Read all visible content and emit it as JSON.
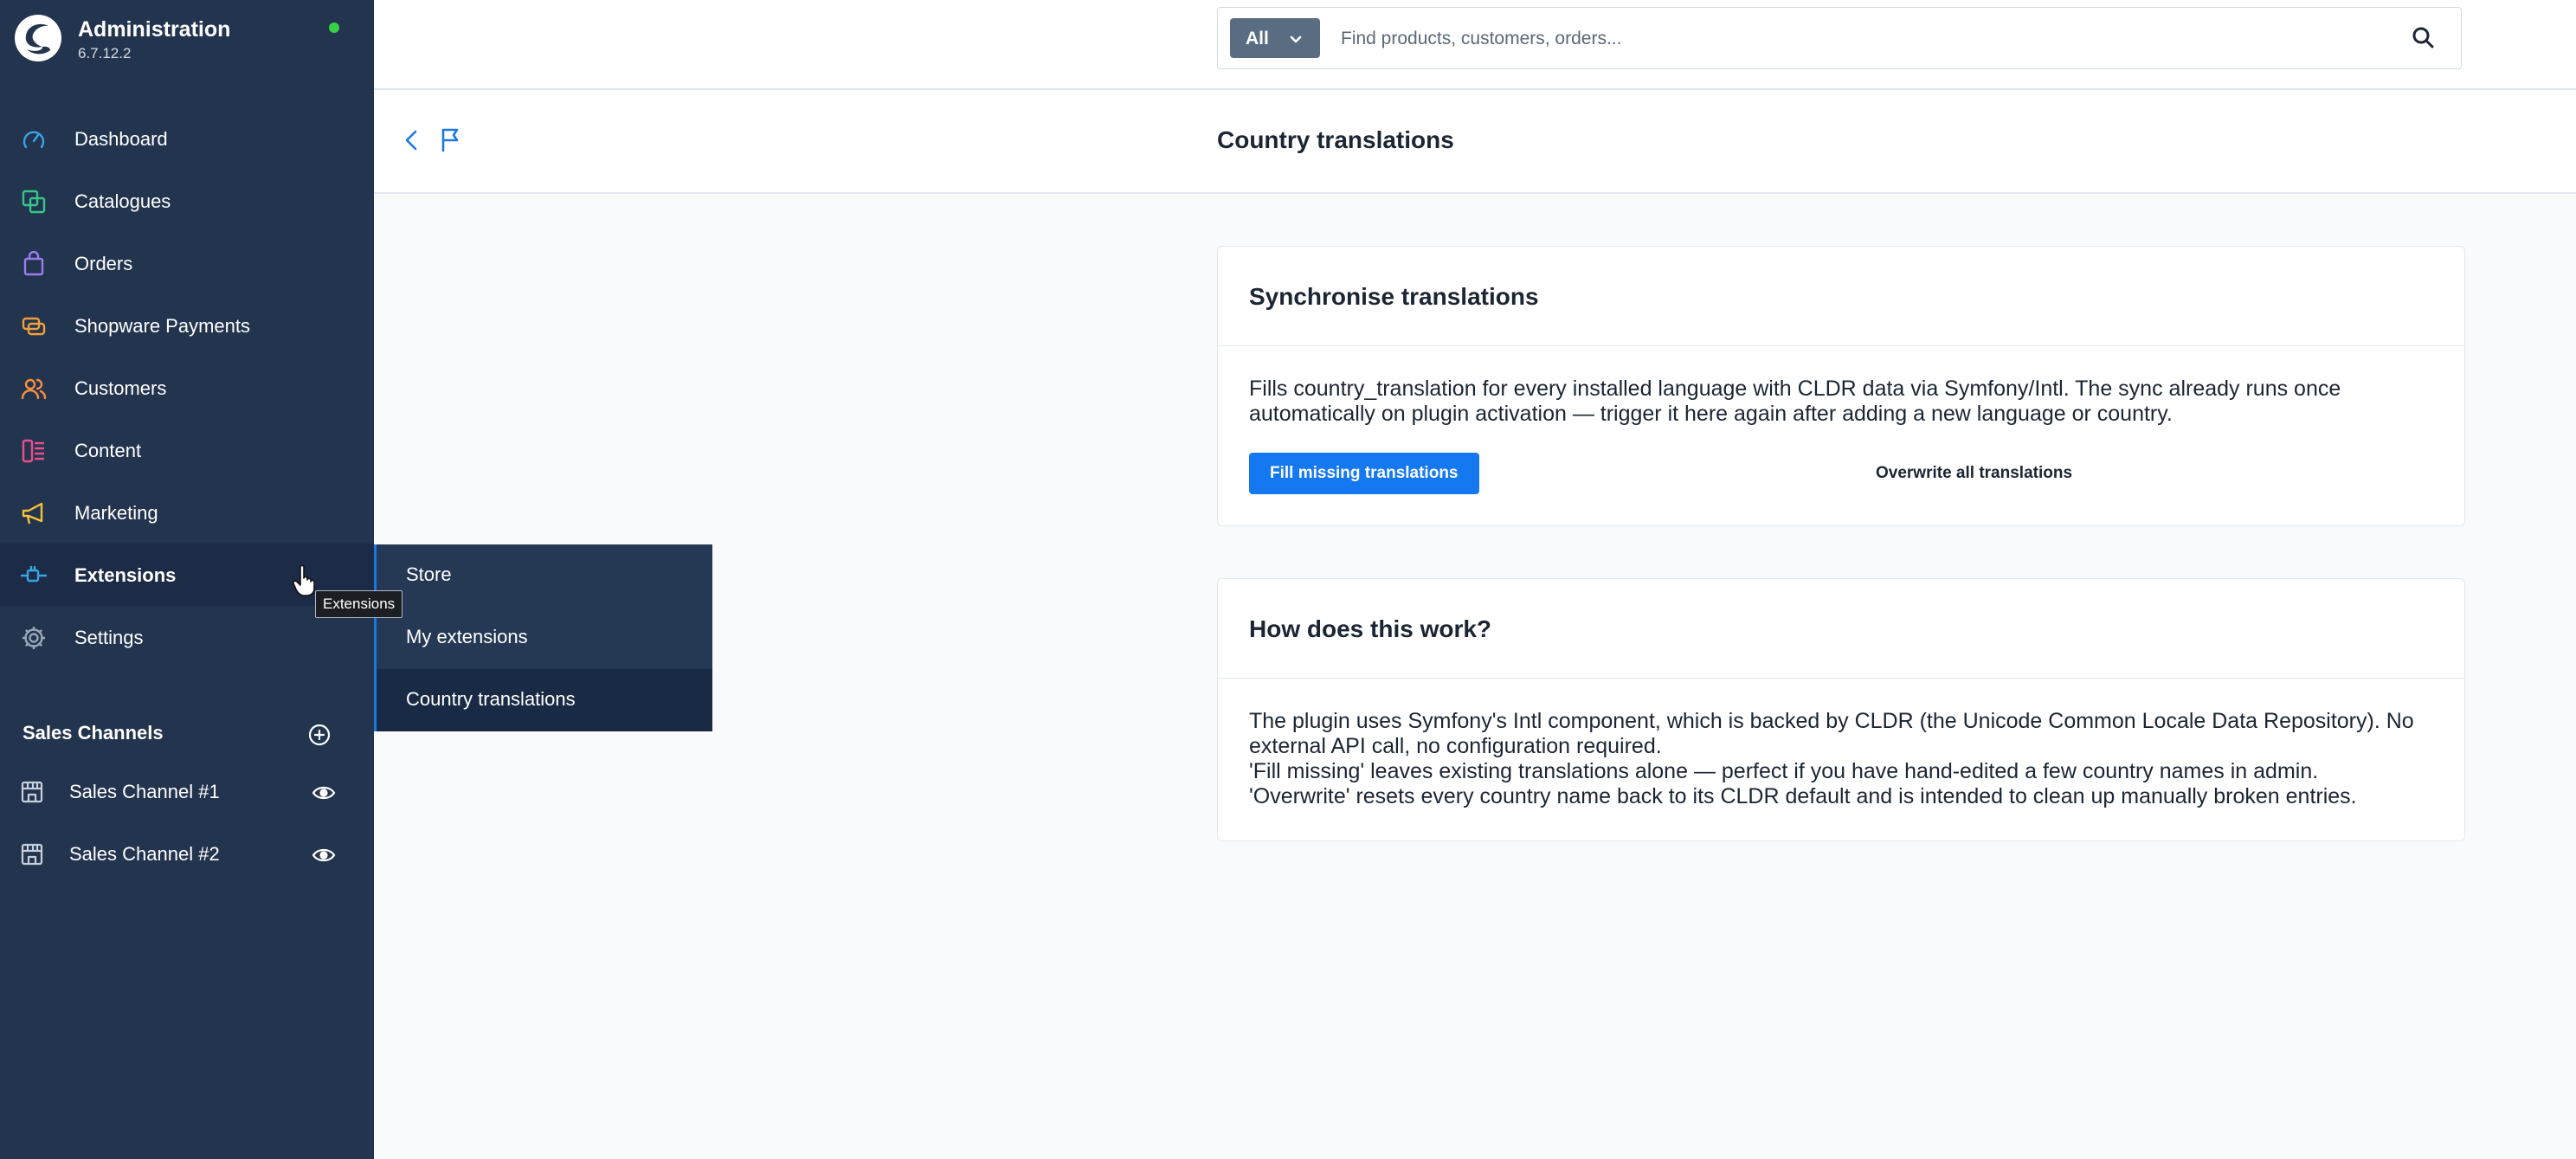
{
  "sidebar": {
    "brand": {
      "title": "Administration",
      "version": "6.7.12.2",
      "status_color": "#37d046"
    },
    "items": [
      {
        "label": "Dashboard",
        "icon": "gauge-icon",
        "color": "#3aa3e5"
      },
      {
        "label": "Catalogues",
        "icon": "catalogue-icon",
        "color": "#37c58a"
      },
      {
        "label": "Orders",
        "icon": "shopping-bag-icon",
        "color": "#9b7cf0"
      },
      {
        "label": "Shopware Payments",
        "icon": "payment-icon",
        "color": "#f2a03a"
      },
      {
        "label": "Customers",
        "icon": "users-icon",
        "color": "#f58f3c"
      },
      {
        "label": "Content",
        "icon": "content-icon",
        "color": "#e8508a"
      },
      {
        "label": "Marketing",
        "icon": "megaphone-icon",
        "color": "#f5c23a"
      },
      {
        "label": "Extensions",
        "icon": "plug-icon",
        "color": "#3aa3e5"
      },
      {
        "label": "Settings",
        "icon": "gear-icon",
        "color": "#9aa6b5"
      }
    ],
    "sales_channels": {
      "title": "Sales Channels",
      "items": [
        {
          "label": "Sales Channel #1"
        },
        {
          "label": "Sales Channel #2"
        }
      ]
    }
  },
  "flyout": {
    "items": [
      {
        "label": "Store"
      },
      {
        "label": "My extensions"
      },
      {
        "label": "Country translations"
      }
    ]
  },
  "tooltip": {
    "text": "Extensions"
  },
  "search": {
    "type_label": "All",
    "placeholder": "Find products, customers, orders..."
  },
  "page": {
    "title": "Country translations"
  },
  "cards": {
    "sync": {
      "title": "Synchronise translations",
      "text": "Fills country_translation for every installed language with CLDR data via Symfony/Intl. The sync already runs once automatically on plugin activation — trigger it here again after adding a new language or country.",
      "primary_button": "Fill missing translations",
      "secondary_button": "Overwrite all translations"
    },
    "how": {
      "title": "How does this work?",
      "lines": [
        "The plugin uses Symfony's Intl component, which is backed by CLDR (the Unicode Common Locale Data Repository). No external API call, no configuration required.",
        "'Fill missing' leaves existing translations alone — perfect if you have hand-edited a few country names in admin.",
        "'Overwrite' resets every country name back to its CLDR default and is intended to clean up manually broken entries."
      ]
    }
  }
}
